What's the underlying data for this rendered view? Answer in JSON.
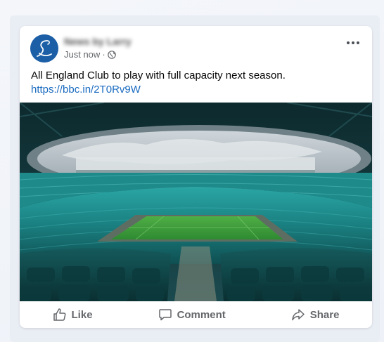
{
  "post": {
    "author": "News by Larry",
    "timestamp": "Just now",
    "separator": "·",
    "privacy_icon": "globe-icon",
    "text": "All England Club to play with full capacity next season.",
    "link": "https://bbc.in/2T0Rv9W",
    "image_alt": "Empty Centre Court stadium with retractable roof open and green teal seats",
    "avatar_glyph": "L"
  },
  "actions": {
    "like_label": "Like",
    "comment_label": "Comment",
    "share_label": "Share"
  },
  "colors": {
    "accent": "#1a6bc0",
    "avatar_bg": "#1d5fa7",
    "seat_teal": "#1c8f8f",
    "grass": "#3f9a3a"
  }
}
